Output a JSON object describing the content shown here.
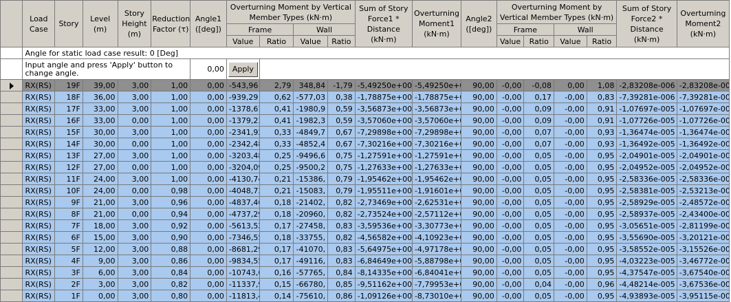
{
  "headers": {
    "load_case": "Load Case",
    "story": "Story",
    "level": "Level (m)",
    "story_height": "Story Height (m)",
    "reduction_factor": "Reduction Factor (τ)",
    "angle1": "Angle1 ([deg])",
    "otm_group": "Overturning Moment by Vertical Member Types (kN·m)",
    "frame": "Frame",
    "wall": "Wall",
    "value": "Value",
    "ratio": "Ratio",
    "sum_force1": "Sum of Story Force1 * Distance (kN·m)",
    "otm1": "Overturning Moment1 (kN·m)",
    "angle2": "Angle2 ([deg])",
    "sum_force2": "Sum of Story Force2 * Distance (kN·m)",
    "otm2": "Overturning Moment2 (kN·m)"
  },
  "info_row": "Angle for static load case result: 0 [Deg]",
  "input_row": {
    "text": "Input angle and press 'Apply' button to change angle.",
    "angle_value": "0,00",
    "apply_label": "Apply"
  },
  "rows": [
    [
      "RX(RS)",
      "19F",
      "39,00",
      "3,00",
      "1,00",
      "0,00",
      "-543,96",
      "2,79",
      "348,84",
      "-1,79",
      "-5,49250e+002",
      "-5,49250e+00",
      "90,00",
      "-0,00",
      "-0,08",
      "0,00",
      "1,08",
      "-2,83208e-006",
      "-2,83208e-00"
    ],
    [
      "RX(RS)",
      "18F",
      "36,00",
      "3,00",
      "1,00",
      "0,00",
      "-939,29",
      "0,62",
      "-577,03",
      "0,38",
      "-1,78875e+003",
      "-1,78875e+0",
      "90,00",
      "-0,00",
      "0,17",
      "-0,00",
      "0,83",
      "-7,39281e-006",
      "-7,39281e-00"
    ],
    [
      "RX(RS)",
      "17F",
      "33,00",
      "3,00",
      "1,00",
      "0,00",
      "-1378,61",
      "0,41",
      "-1980,9",
      "0,59",
      "-3,56873e+003",
      "-3,56873e+0",
      "90,00",
      "-0,00",
      "0,09",
      "-0,00",
      "0,91",
      "-1,07697e-005",
      "-1,07697e-00"
    ],
    [
      "RX(RS)",
      "16F",
      "33,00",
      "0,00",
      "1,00",
      "0,00",
      "-1379,23",
      "0,41",
      "-1982,3",
      "0,59",
      "-3,57060e+003",
      "-3,57060e+0",
      "90,00",
      "-0,00",
      "0,09",
      "-0,00",
      "0,91",
      "-1,07726e-005",
      "-1,07726e-00"
    ],
    [
      "RX(RS)",
      "15F",
      "30,00",
      "3,00",
      "1,00",
      "0,00",
      "-2341,92",
      "0,33",
      "-4849,7",
      "0,67",
      "-7,29898e+003",
      "-7,29898e+0",
      "90,00",
      "-0,00",
      "0,07",
      "-0,00",
      "0,93",
      "-1,36474e-005",
      "-1,36474e-00"
    ],
    [
      "RX(RS)",
      "14F",
      "30,00",
      "0,00",
      "1,00",
      "0,00",
      "-2342,48",
      "0,33",
      "-4852,4",
      "0,67",
      "-7,30216e+003",
      "-7,30216e+0",
      "90,00",
      "-0,00",
      "0,07",
      "-0,00",
      "0,93",
      "-1,36492e-005",
      "-1,36492e-00"
    ],
    [
      "RX(RS)",
      "13F",
      "27,00",
      "3,00",
      "1,00",
      "0,00",
      "-3203,48",
      "0,25",
      "-9496,6",
      "0,75",
      "-1,27591e+004",
      "-1,27591e+0",
      "90,00",
      "-0,00",
      "0,05",
      "-0,00",
      "0,95",
      "-2,04901e-005",
      "-2,04901e-00"
    ],
    [
      "RX(RS)",
      "12F",
      "27,00",
      "0,00",
      "1,00",
      "0,00",
      "-3204,09",
      "0,25",
      "-9500,2",
      "0,75",
      "-1,27633e+004",
      "-1,27633e+0",
      "90,00",
      "-0,00",
      "0,05",
      "-0,00",
      "0,95",
      "-2,04952e-005",
      "-2,04952e-00"
    ],
    [
      "RX(RS)",
      "11F",
      "24,00",
      "3,00",
      "1,00",
      "0,00",
      "-4130,74",
      "0,21",
      "-15386,",
      "0,79",
      "-1,95462e+004",
      "-1,95462e+0",
      "90,00",
      "-0,00",
      "0,05",
      "-0,00",
      "0,95",
      "-2,58336e-005",
      "-2,58336e-00"
    ],
    [
      "RX(RS)",
      "10F",
      "24,00",
      "0,00",
      "0,98",
      "0,00",
      "-4048,73",
      "0,21",
      "-15083,",
      "0,79",
      "-1,95511e+004",
      "-1,91601e+0",
      "90,00",
      "-0,00",
      "0,05",
      "-0,00",
      "0,95",
      "-2,58381e-005",
      "-2,53213e-00"
    ],
    [
      "RX(RS)",
      "9F",
      "21,00",
      "3,00",
      "0,96",
      "0,00",
      "-4837,46",
      "0,18",
      "-21402,",
      "0,82",
      "-2,73469e+004",
      "-2,62531e+0",
      "90,00",
      "-0,00",
      "0,05",
      "-0,00",
      "0,95",
      "-2,58929e-005",
      "-2,48572e-00"
    ],
    [
      "RX(RS)",
      "8F",
      "21,00",
      "0,00",
      "0,94",
      "0,00",
      "-4737,29",
      "0,18",
      "-20960,",
      "0,82",
      "-2,73524e+004",
      "-2,57112e+0",
      "90,00",
      "-0,00",
      "0,05",
      "-0,00",
      "0,95",
      "-2,58937e-005",
      "-2,43400e-00"
    ],
    [
      "RX(RS)",
      "7F",
      "18,00",
      "3,00",
      "0,92",
      "0,00",
      "-5613,52",
      "0,17",
      "-27458,",
      "0,83",
      "-3,59536e+004",
      "-3,30773e+0",
      "90,00",
      "-0,00",
      "0,05",
      "-0,00",
      "0,95",
      "-3,05651e-005",
      "-2,81199e-00"
    ],
    [
      "RX(RS)",
      "6F",
      "15,00",
      "3,00",
      "0,90",
      "0,00",
      "-7346,55",
      "0,18",
      "-33755,",
      "0,82",
      "-4,56582e+004",
      "-4,10923e+0",
      "90,00",
      "-0,00",
      "0,05",
      "-0,00",
      "0,95",
      "-3,55690e-005",
      "-3,20121e-00"
    ],
    [
      "RX(RS)",
      "5F",
      "12,00",
      "3,00",
      "0,88",
      "0,00",
      "-8681,29",
      "0,17",
      "-41070,",
      "0,83",
      "-5,64975e+004",
      "-4,97178e+0",
      "90,00",
      "-0,00",
      "0,05",
      "-0,00",
      "0,95",
      "-3,58552e-005",
      "-3,15526e-00"
    ],
    [
      "RX(RS)",
      "4F",
      "9,00",
      "3,00",
      "0,86",
      "0,00",
      "-9834,55",
      "0,17",
      "-49116,",
      "0,83",
      "-6,84649e+004",
      "-5,88798e+0",
      "90,00",
      "-0,00",
      "0,05",
      "-0,00",
      "0,95",
      "-4,03223e-005",
      "-3,46772e-00"
    ],
    [
      "RX(RS)",
      "3F",
      "6,00",
      "3,00",
      "0,84",
      "0,00",
      "-10743,6",
      "0,16",
      "-57765,",
      "0,84",
      "-8,14335e+004",
      "-6,84041e+0",
      "90,00",
      "-0,00",
      "0,05",
      "-0,00",
      "0,95",
      "-4,37547e-005",
      "-3,67540e-00"
    ],
    [
      "RX(RS)",
      "2F",
      "3,00",
      "3,00",
      "0,82",
      "0,00",
      "-11337,9",
      "0,15",
      "-66780,",
      "0,85",
      "-9,51162e+004",
      "-7,79953e+0",
      "90,00",
      "-0,00",
      "0,04",
      "-0,00",
      "0,96",
      "-4,48214e-005",
      "-3,67536e-00"
    ],
    [
      "RX(RS)",
      "1F",
      "0,00",
      "3,00",
      "0,80",
      "0,00",
      "-11813,4",
      "0,14",
      "-75610,",
      "0,86",
      "-1,09126e+005",
      "-8,73010e+0",
      "90,00",
      "-0,00",
      "0,05",
      "-0,00",
      "0,95",
      "-4,93893e-005",
      "-3,95115e-00"
    ]
  ],
  "current_row_index": 0
}
